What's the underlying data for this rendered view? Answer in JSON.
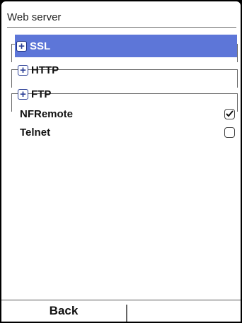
{
  "header": {
    "title": "Web server"
  },
  "groups": [
    {
      "label": "SSL",
      "selected": true,
      "expand_icon": "plus-box-icon"
    },
    {
      "label": "HTTP",
      "selected": false,
      "expand_icon": "plus-box-icon"
    },
    {
      "label": "FTP",
      "selected": false,
      "expand_icon": "plus-box-icon"
    }
  ],
  "options": [
    {
      "label": "NFRemote",
      "checked": true
    },
    {
      "label": "Telnet",
      "checked": false
    }
  ],
  "softkeys": {
    "left": "Back",
    "right": ""
  },
  "colors": {
    "selection": "#5d76d8",
    "icon_border": "#2b3f96"
  }
}
